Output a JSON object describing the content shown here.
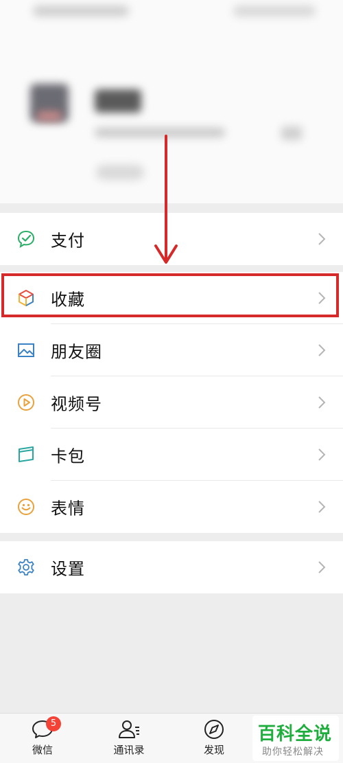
{
  "menu": {
    "group1": [
      {
        "label": "支付",
        "icon": "pay-icon"
      }
    ],
    "group2": [
      {
        "label": "收藏",
        "icon": "favorites-icon"
      },
      {
        "label": "朋友圈",
        "icon": "moments-icon"
      },
      {
        "label": "视频号",
        "icon": "channels-icon"
      },
      {
        "label": "卡包",
        "icon": "card-wallet-icon"
      },
      {
        "label": "表情",
        "icon": "stickers-icon"
      }
    ],
    "group3": [
      {
        "label": "设置",
        "icon": "settings-icon"
      }
    ]
  },
  "tabbar": {
    "chats_label": "微信",
    "chats_badge": "5",
    "contacts_label": "通讯录",
    "discover_label": "发现"
  },
  "watermark": {
    "title": "百科全说",
    "subtitle": "助你轻松解决"
  },
  "colors": {
    "highlight": "#d62a2a",
    "arrow": "#d62a2a",
    "badge": "#f44336",
    "watermark_green": "#1fae3e"
  }
}
